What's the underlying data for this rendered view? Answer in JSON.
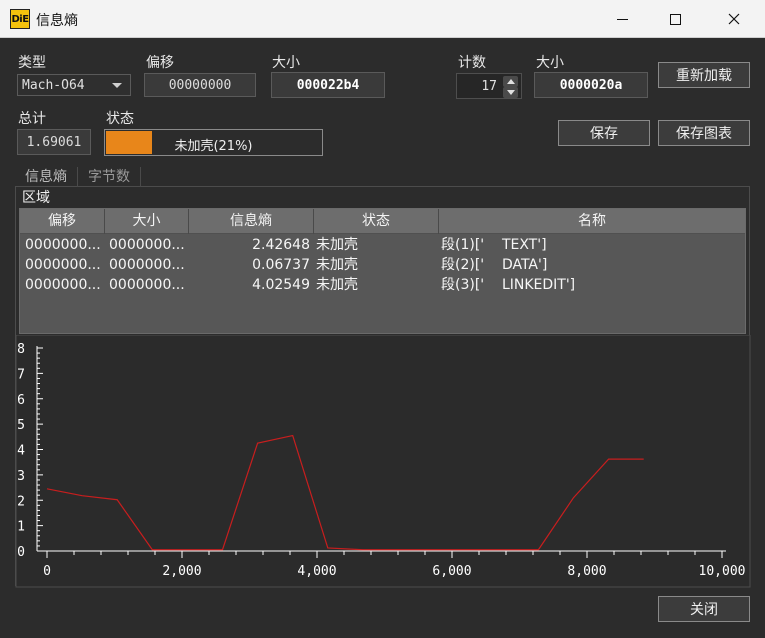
{
  "window": {
    "title": "信息熵",
    "icon_text": "DiE"
  },
  "header": {
    "type_label": "类型",
    "type_value": "Mach-O64",
    "offset_label": "偏移",
    "offset_value": "00000000",
    "size_label": "大小",
    "size_value": "000022b4",
    "count_label": "计数",
    "count_value": "17",
    "size2_label": "大小",
    "size2_value": "0000020a",
    "reload_button": "重新加载",
    "total_label": "总计",
    "total_value": "1.69061",
    "status_label": "状态",
    "status_text": "未加壳(21%)",
    "status_progress": 0.21,
    "save_button": "保存",
    "save_chart_button": "保存图表"
  },
  "tabs": [
    {
      "label": "信息熵",
      "active": true
    },
    {
      "label": "字节数",
      "active": false
    }
  ],
  "regions": {
    "title": "区域",
    "columns": [
      "偏移",
      "大小",
      "信息熵",
      "状态",
      "名称"
    ],
    "rows": [
      {
        "offset": "0000000...",
        "size": "0000000...",
        "entropy": "2.42648",
        "status": "未加壳",
        "name": "段(1)['    TEXT']"
      },
      {
        "offset": "0000000...",
        "size": "0000000...",
        "entropy": "0.06737",
        "status": "未加壳",
        "name": "段(2)['    DATA']"
      },
      {
        "offset": "0000000...",
        "size": "0000000...",
        "entropy": "4.02549",
        "status": "未加壳",
        "name": "段(3)['    LINKEDIT']"
      }
    ]
  },
  "close_button": "关闭",
  "colors": {
    "progress_fill": "#e8861a",
    "line": "#c81e1e"
  },
  "chart_data": {
    "type": "line",
    "title": "",
    "xlabel": "",
    "ylabel": "",
    "xlim": [
      0,
      10000
    ],
    "ylim": [
      0,
      8
    ],
    "x_ticks": [
      0,
      2000,
      4000,
      6000,
      8000,
      10000
    ],
    "x_tick_labels": [
      "0",
      "2,000",
      "4,000",
      "6,000",
      "8,000",
      "10,000"
    ],
    "y_ticks": [
      0,
      1,
      2,
      3,
      4,
      5,
      6,
      7,
      8
    ],
    "y_tick_labels": [
      "0",
      "1",
      "2",
      "3",
      "4",
      "5",
      "6",
      "7",
      "8"
    ],
    "grid": false,
    "series": [
      {
        "x": [
          0,
          520,
          1040,
          1560,
          2600,
          3120,
          3640,
          4160,
          4680,
          5200,
          5720,
          6240,
          6760,
          7280,
          7800,
          8320,
          8840
        ],
        "y": [
          2.45,
          2.18,
          2.02,
          0.05,
          0.05,
          4.25,
          4.55,
          0.12,
          0.05,
          0.05,
          0.05,
          0.05,
          0.05,
          0.05,
          2.1,
          3.62,
          3.62
        ]
      }
    ]
  }
}
